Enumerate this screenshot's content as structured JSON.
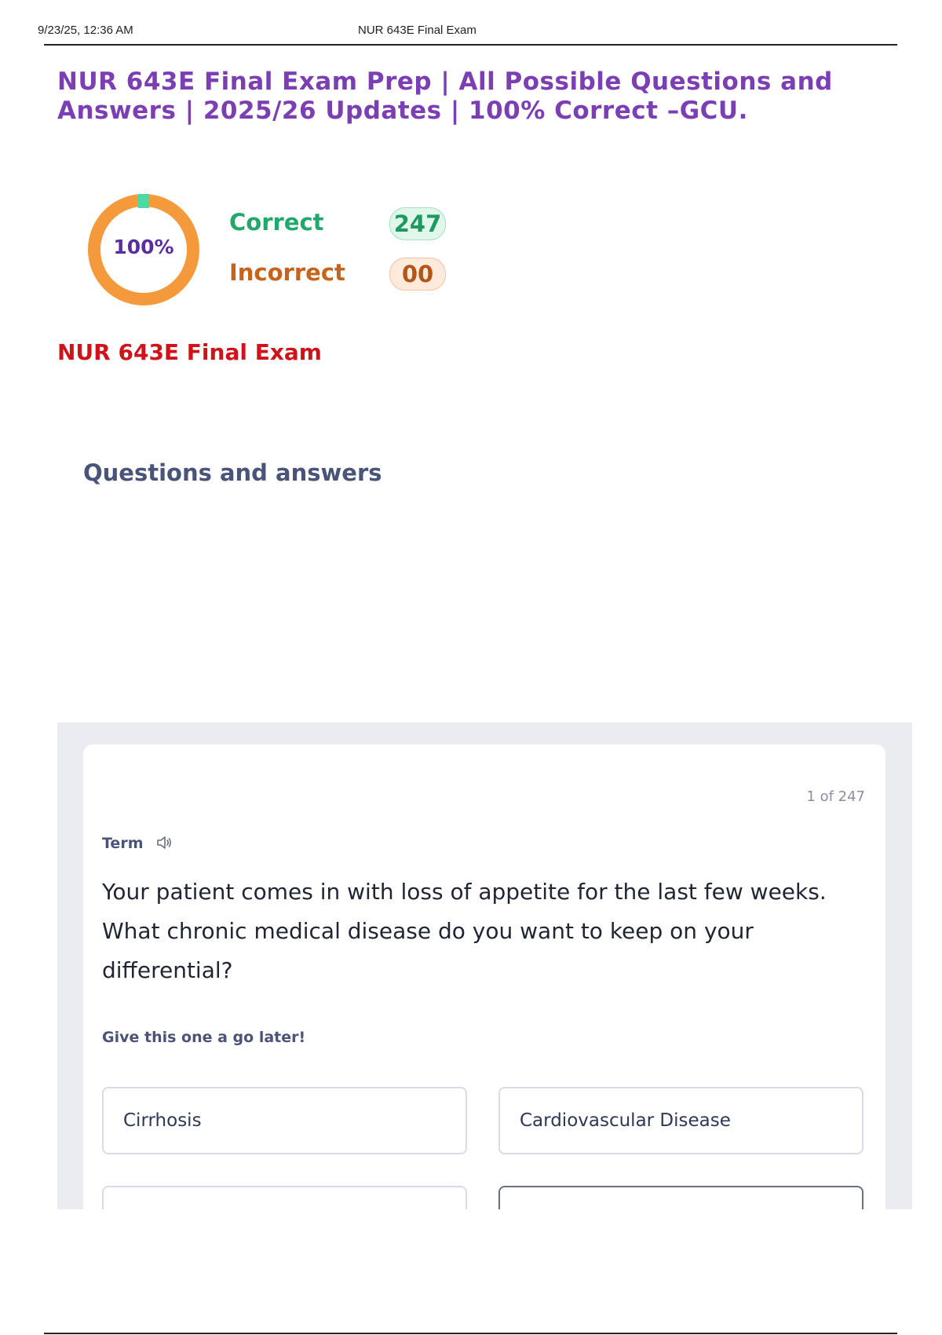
{
  "print_header": {
    "date": "9/23/25, 12:36 AM",
    "page_title": "NUR 643E Final Exam"
  },
  "document": {
    "title": "NUR 643E Final Exam Prep | All Possible Questions and Answers | 2025/26 Updates | 100% Correct –GCU.",
    "exam_name": "NUR 643E Final Exam",
    "section_heading": "Questions and answers"
  },
  "score": {
    "percent_label": "100%",
    "percent_value": 100,
    "correct_label": "Correct",
    "correct_count": "247",
    "incorrect_label": "Incorrect",
    "incorrect_count": "00",
    "colors": {
      "correct": "#22a86a",
      "incorrect": "#c8631a",
      "ring": "#f59a3c",
      "ring_marker": "#4dd9a6"
    }
  },
  "card": {
    "counter": "1 of 247",
    "term_label": "Term",
    "audio_icon": "speaker-icon",
    "question": "Your patient comes in with loss of appetite for the last few weeks. What chronic medical disease do you want to keep on your differential?",
    "hint": "Give this one a go later!",
    "options": [
      "Cirrhosis",
      "Cardiovascular Disease",
      "",
      ""
    ]
  }
}
